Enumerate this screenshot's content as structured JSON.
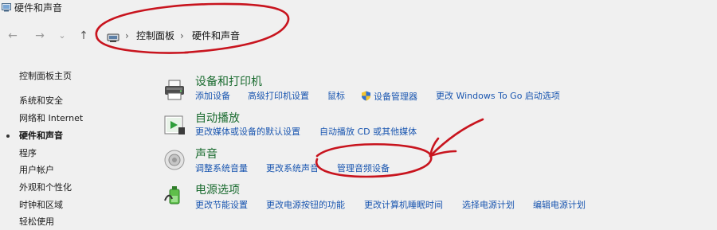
{
  "window": {
    "title": "硬件和声音"
  },
  "nav": {
    "back": "←",
    "forward": "→",
    "recent": "⌄",
    "up": "↑",
    "sep1": "›",
    "sep2": "›",
    "breadcrumb": [
      "控制面板",
      "硬件和声音"
    ]
  },
  "sidebar": {
    "items": [
      {
        "label": "控制面板主页"
      },
      {
        "label": "系统和安全"
      },
      {
        "label": "网络和 Internet"
      },
      {
        "label": "硬件和声音",
        "active": true
      },
      {
        "label": "程序"
      },
      {
        "label": "用户帐户"
      },
      {
        "label": "外观和个性化"
      },
      {
        "label": "时钟和区域"
      },
      {
        "label": "轻松使用"
      }
    ]
  },
  "categories": [
    {
      "title": "设备和打印机",
      "icon": "printer-icon",
      "links": [
        "添加设备",
        "高级打印机设置",
        "鼠标",
        "设备管理器",
        "更改 Windows To Go 启动选项"
      ]
    },
    {
      "title": "自动播放",
      "icon": "autoplay-icon",
      "links": [
        "更改媒体或设备的默认设置",
        "自动播放 CD 或其他媒体"
      ]
    },
    {
      "title": "声音",
      "icon": "speaker-icon",
      "links": [
        "调整系统音量",
        "更改系统声音",
        "管理音频设备"
      ]
    },
    {
      "title": "电源选项",
      "icon": "power-options-icon",
      "links": [
        "更改节能设置",
        "更改电源按钮的功能",
        "更改计算机睡眠时间",
        "选择电源计划",
        "编辑电源计划"
      ]
    }
  ],
  "colors": {
    "link": "#1a56b0",
    "category_title": "#1a6b2f",
    "annotation": "#c8141e",
    "background": "#f0f0f0"
  }
}
